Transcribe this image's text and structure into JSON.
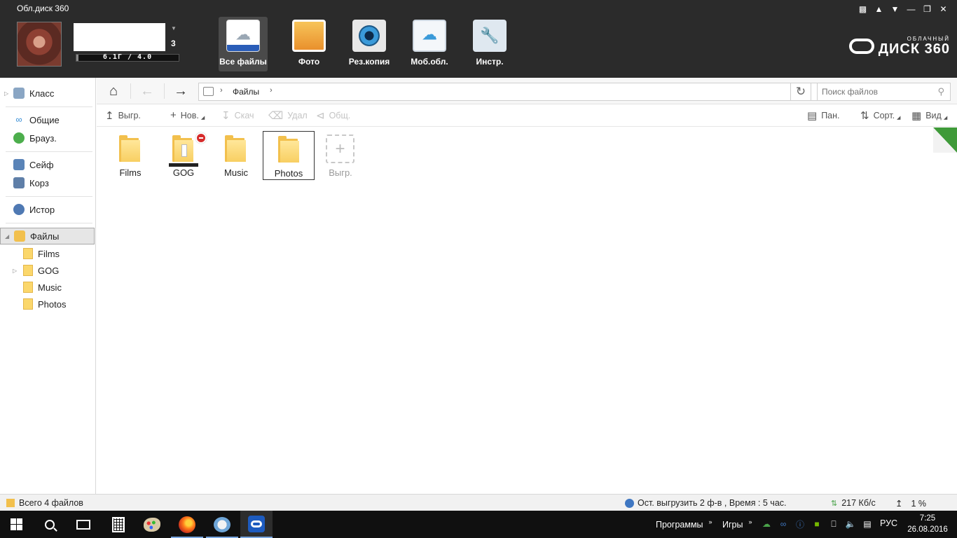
{
  "app": {
    "title": "Обл.диск 360"
  },
  "window_controls": [
    "feedback-icon",
    "skin-icon",
    "menu-icon",
    "minimize-icon",
    "maximize-icon",
    "close-icon"
  ],
  "user": {
    "level": "3",
    "quota_text": "6.1Г / 4.0"
  },
  "nav_tabs": [
    {
      "label": "Все файлы",
      "icon": "all-files-icon",
      "active": true
    },
    {
      "label": "Фото",
      "icon": "photo-icon"
    },
    {
      "label": "Рез.копия",
      "icon": "backup-camera-icon"
    },
    {
      "label": "Моб.обл.",
      "icon": "mobile-cloud-icon"
    },
    {
      "label": "Инстр.",
      "icon": "tools-icon"
    }
  ],
  "brand": {
    "small": "ОБЛАЧНЫЙ",
    "big": "ДИСК 360"
  },
  "sidebar": {
    "items": [
      {
        "label": "Класс",
        "icon": "class-icon"
      },
      {
        "label": "Общие",
        "icon": "share-icon"
      },
      {
        "label": "Брауз.",
        "icon": "browser-icon"
      },
      {
        "label": "Сейф",
        "icon": "safe-icon"
      },
      {
        "label": "Корз",
        "icon": "trash-icon"
      },
      {
        "label": "Истор",
        "icon": "history-icon"
      },
      {
        "label": "Файлы",
        "icon": "files-icon",
        "selected": true
      }
    ],
    "folders": [
      "Films",
      "GOG",
      "Music",
      "Photos"
    ]
  },
  "navbar": {
    "breadcrumb": "Файлы",
    "search_placeholder": "Поиск файлов"
  },
  "toolbar": {
    "upload": "Выгр.",
    "new": "Нов.",
    "download": "Скач",
    "delete": "Удал",
    "share": "Общ.",
    "panel": "Пан.",
    "sort": "Сорт.",
    "view": "Вид"
  },
  "files": [
    {
      "name": "Films"
    },
    {
      "name": "GOG",
      "badge": "no-sync"
    },
    {
      "name": "Music"
    },
    {
      "name": "Photos",
      "selected": true
    }
  ],
  "upload_tile": "Выгр.",
  "status": {
    "total": "Всего 4 файлов",
    "upload": "Ост. выгрузить 2 ф-в , Время :  5 час.",
    "speed": "217 Кб/с",
    "percent": "1 %"
  },
  "taskbar": {
    "programs": "Программы",
    "games": "Игры",
    "lang": "РУС",
    "time": "7:25",
    "date": "26.08.2016",
    "apps": [
      "start-icon",
      "search-icon",
      "task-view-icon",
      "calculator-icon",
      "paint-icon",
      "firefox-icon",
      "mail-icon",
      "disk360-icon"
    ]
  }
}
